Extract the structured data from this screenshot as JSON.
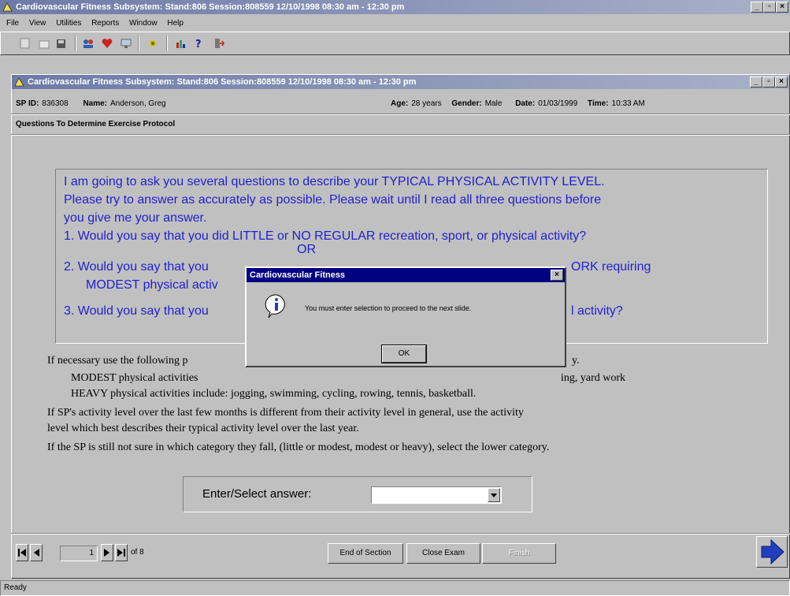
{
  "app": {
    "title": "Cardiovascular Fitness Subsystem: Stand:806 Session:808559 12/10/1998 08:30 am - 12:30 pm",
    "menu": [
      "File",
      "View",
      "Utilities",
      "Reports",
      "Window",
      "Help"
    ]
  },
  "child": {
    "title": "Cardiovascular Fitness Subsystem: Stand:806 Session:808559 12/10/1998 08:30 am - 12:30 pm"
  },
  "header": {
    "sp_id_label": "SP ID:",
    "sp_id": "836308",
    "name_label": "Name:",
    "name": "Anderson, Greg",
    "age_label": "Age:",
    "age": "28 years",
    "gender_label": "Gender:",
    "gender": "Male",
    "date_label": "Date:",
    "date": "01/03/1999",
    "time_label": "Time:",
    "time": "10:33 AM"
  },
  "section_title": "Questions To Determine Exercise Protocol",
  "questions": {
    "intro1": "I am going to ask you several questions to describe your TYPICAL PHYSICAL ACTIVITY LEVEL.",
    "intro2": "Please try to answer as accurately as possible. Please wait until I read all three questions before",
    "intro3": "you give me your answer.",
    "q1": "1.  Would you say that you did LITTLE or NO REGULAR recreation, sport, or physical activity?",
    "or": "OR",
    "q2a": "2.  Would you say that you",
    "q2b": "ORK requiring",
    "q2c": "MODEST physical activ",
    "q3a": "3.  Would you say that you",
    "q3b": "l activity?"
  },
  "instructions": {
    "line1": "If necessary use the following p",
    "line1_end": "y.",
    "modest": "MODEST physical activities",
    "modest_end": "ing, yard work",
    "heavy": "HEAVY physical activities include: jogging, swimming, cycling, rowing, tennis, basketball.",
    "p2a": "If SP's activity level over the last few months is different from their activity level in general, use the activity",
    "p2b": "level which best describes their typical activity level over the last year.",
    "p3": "If the SP is still not sure in which category they fall, (little or modest, modest or heavy), select the lower category."
  },
  "answer": {
    "label": "Enter/Select answer:",
    "value": ""
  },
  "nav": {
    "page": "1",
    "of_label": "of 8",
    "end_section": "End of Section",
    "close_exam": "Close Exam",
    "finish": "Finish"
  },
  "dialog": {
    "title": "Cardiovascular Fitness",
    "message": "You must enter selection to proceed to the next slide.",
    "ok": "OK"
  },
  "status": "Ready",
  "colors": {
    "question_text": "#1f1fd2",
    "dialog_title": "#000080",
    "title_bar": "#6d7aa6"
  }
}
